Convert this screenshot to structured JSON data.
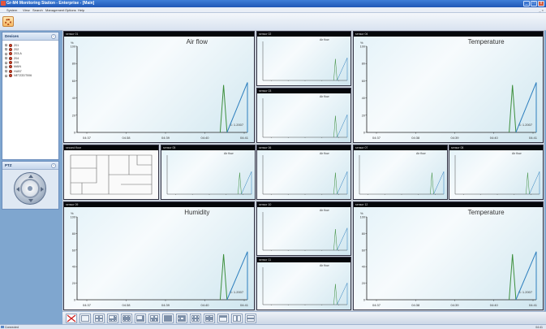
{
  "window": {
    "title": "Gr-M4 Monitoring Station - Enterprise - [Main]",
    "buttons": [
      "_",
      "□",
      "x"
    ]
  },
  "menubar": {
    "items": [
      "System",
      "View",
      "Search",
      "Management",
      "Options",
      "Help"
    ],
    "mdi_controls": "_ ×"
  },
  "devices_panel": {
    "title": "Devices",
    "items": [
      {
        "label": "Z01"
      },
      {
        "label": "Z02"
      },
      {
        "label": "Z03-A"
      },
      {
        "label": "Z04"
      },
      {
        "label": "Z05"
      },
      {
        "label": "MAIN"
      },
      {
        "label": "HUB7"
      },
      {
        "label": "NETZ2DT006"
      }
    ]
  },
  "ptz_panel": {
    "title": "PTZ"
  },
  "tiles": [
    {
      "id": "t1",
      "header": "sensor 01",
      "title": "Air flow",
      "size": "large",
      "readout": "S: 1.2007",
      "ylabel": "%",
      "yticks": [
        "100",
        "80",
        "60",
        "40",
        "20",
        "0"
      ],
      "xticks": [
        "04:37",
        "04:38",
        "04:39",
        "04:40",
        "04:41"
      ]
    },
    {
      "id": "t2",
      "header": "sensor 02",
      "title": "Air flow",
      "size": "small"
    },
    {
      "id": "t3",
      "header": "sensor 03",
      "title": "Air flow",
      "size": "small"
    },
    {
      "id": "t4",
      "header": "sensor 04",
      "title": "Temperature",
      "size": "large",
      "readout": "S: 1.2007",
      "ylabel": "%",
      "yticks": [
        "100",
        "80",
        "60",
        "40",
        "20",
        "0"
      ],
      "xticks": [
        "04:37",
        "04:38",
        "04:39",
        "04:40",
        "04:41"
      ]
    },
    {
      "id": "t5",
      "header": "sensor 05",
      "title": "Air flow",
      "size": "small"
    },
    {
      "id": "t6",
      "header": "sensor 06",
      "title": "Air flow",
      "size": "small"
    },
    {
      "id": "t7",
      "header": "sensor 07",
      "title": "Air flow",
      "size": "small"
    },
    {
      "id": "t8",
      "header": "sensor 08",
      "title": "Air flow",
      "size": "small"
    },
    {
      "id": "t9",
      "header": "sensor 09",
      "title": "Humidity",
      "size": "large",
      "readout": "S: 1.2007",
      "ylabel": "%",
      "yticks": [
        "100",
        "80",
        "60",
        "40",
        "20",
        "0"
      ],
      "xticks": [
        "04:37",
        "04:38",
        "04:39",
        "04:40",
        "04:41"
      ]
    },
    {
      "id": "t10",
      "header": "sensor 10",
      "title": "Air flow",
      "size": "small"
    },
    {
      "id": "t11",
      "header": "sensor 11",
      "title": "Air flow",
      "size": "small"
    },
    {
      "id": "t12",
      "header": "sensor 12",
      "title": "Temperature",
      "size": "large",
      "readout": "S: 1.2007",
      "ylabel": "%",
      "yticks": [
        "100",
        "80",
        "60",
        "40",
        "20",
        "0"
      ],
      "xticks": [
        "04:37",
        "04:38",
        "04:39",
        "04:40",
        "04:41"
      ]
    }
  ],
  "floorplan": {
    "header": "second floor"
  },
  "series_shape": {
    "type": "line",
    "x": [
      0.0,
      0.2,
      0.42,
      0.65,
      0.85,
      1.0
    ],
    "points_note": "",
    "values": [
      {
        "t": 0.84,
        "v": 0
      },
      {
        "t": 0.86,
        "v": 55
      },
      {
        "t": 0.88,
        "v": 0
      },
      {
        "t": 1.0,
        "v": 58
      },
      {
        "t": 1.0,
        "v": 0
      }
    ]
  },
  "layout_buttons": [
    "clear",
    "1x1",
    "2x2",
    "1+5",
    "3x3",
    "1+7",
    "2+8",
    "4x4",
    "1+12",
    "3+9",
    "2x6",
    "5x5",
    "6x6",
    "custom"
  ],
  "statusbar": {
    "left": "Connected",
    "right": "04:41"
  },
  "colors": {
    "accent": "#1f57b6",
    "series": "#3d8f3d",
    "series_alt": "#2d7fbe"
  }
}
